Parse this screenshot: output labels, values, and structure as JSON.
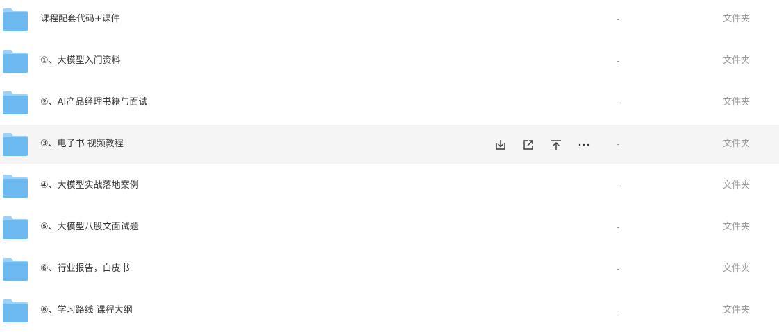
{
  "colors": {
    "folder_front": "#6cb9ef",
    "folder_back": "#9ed0f6",
    "hover_bg": "#f5f5f6",
    "text": "#333333",
    "muted": "#999999",
    "icon": "#333333"
  },
  "rows": [
    {
      "name": "课程配套代码+课件",
      "size": "-",
      "type": "文件夹",
      "icon": "folder-icon"
    },
    {
      "name": "①、大模型入门资料",
      "size": "-",
      "type": "文件夹",
      "icon": "folder-icon"
    },
    {
      "name": "②、AI产品经理书籍与面试",
      "size": "-",
      "type": "文件夹",
      "icon": "folder-icon"
    },
    {
      "name": "③、电子书 视频教程",
      "size": "-",
      "type": "文件夹",
      "icon": "folder-icon",
      "hovered": true
    },
    {
      "name": "④、大模型实战落地案例",
      "size": "-",
      "type": "文件夹",
      "icon": "folder-icon"
    },
    {
      "name": "⑤、大模型八股文面试题",
      "size": "-",
      "type": "文件夹",
      "icon": "folder-icon"
    },
    {
      "name": "⑥、行业报告，白皮书",
      "size": "-",
      "type": "文件夹",
      "icon": "folder-icon"
    },
    {
      "name": "⑧、学习路线 课程大纲",
      "size": "-",
      "type": "文件夹",
      "icon": "folder-icon"
    }
  ],
  "row_actions": [
    {
      "icon": "download-icon"
    },
    {
      "icon": "share-icon"
    },
    {
      "icon": "pin-top-icon"
    },
    {
      "icon": "more-icon"
    }
  ]
}
